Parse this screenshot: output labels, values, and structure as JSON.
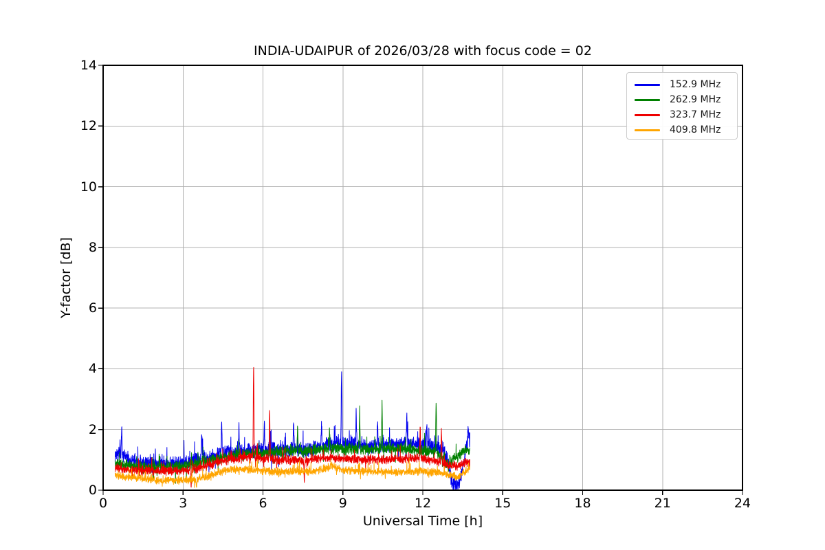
{
  "chart_data": {
    "type": "line",
    "title": "INDIA-UDAIPUR of 2026/03/28 with focus code = 02",
    "xlabel": "Universal Time [h]",
    "ylabel": "Y-factor [dB]",
    "xlim": [
      0,
      24
    ],
    "ylim": [
      0,
      14
    ],
    "xticks": [
      0,
      3,
      6,
      9,
      12,
      15,
      18,
      21,
      24
    ],
    "yticks": [
      0,
      2,
      4,
      6,
      8,
      10,
      12,
      14
    ],
    "grid": true,
    "grid_color": "#b0b0b0",
    "axis_color": "#000000",
    "legend": {
      "position": "upper-right"
    },
    "series": [
      {
        "label": "152.9 MHz",
        "color": "#0000ee",
        "seed": 7,
        "noise_amp": 0.28,
        "x_start": 0.45,
        "x_end": 13.77,
        "mean_points": [
          [
            0.45,
            1.2
          ],
          [
            0.8,
            1.1
          ],
          [
            1.2,
            0.92
          ],
          [
            1.8,
            0.85
          ],
          [
            2.4,
            0.88
          ],
          [
            3.0,
            0.92
          ],
          [
            3.6,
            1.05
          ],
          [
            4.2,
            1.15
          ],
          [
            5.0,
            1.28
          ],
          [
            6.0,
            1.35
          ],
          [
            7.0,
            1.35
          ],
          [
            7.6,
            1.3
          ],
          [
            8.3,
            1.5
          ],
          [
            9.0,
            1.55
          ],
          [
            9.6,
            1.5
          ],
          [
            10.2,
            1.45
          ],
          [
            10.8,
            1.5
          ],
          [
            11.4,
            1.55
          ],
          [
            12.0,
            1.5
          ],
          [
            12.4,
            1.45
          ],
          [
            12.8,
            1.3
          ],
          [
            12.95,
            0.9
          ],
          [
            13.1,
            0.25
          ],
          [
            13.25,
            0.15
          ],
          [
            13.4,
            0.3
          ],
          [
            13.55,
            1.0
          ],
          [
            13.65,
            1.5
          ],
          [
            13.77,
            1.7
          ]
        ],
        "spikes": [
          [
            0.7,
            2.1
          ],
          [
            3.7,
            2.05
          ],
          [
            4.45,
            2.1
          ],
          [
            5.1,
            1.95
          ],
          [
            6.05,
            2.3
          ],
          [
            7.15,
            2.25
          ],
          [
            8.2,
            2.2
          ],
          [
            8.95,
            4.0
          ],
          [
            9.5,
            2.3
          ],
          [
            10.3,
            2.2
          ],
          [
            11.4,
            2.3
          ],
          [
            12.15,
            2.2
          ],
          [
            13.7,
            2.1
          ]
        ]
      },
      {
        "label": "262.9 MHz",
        "color": "#008000",
        "seed": 11,
        "noise_amp": 0.22,
        "x_start": 0.45,
        "x_end": 13.77,
        "mean_points": [
          [
            0.45,
            0.88
          ],
          [
            1.0,
            0.8
          ],
          [
            1.8,
            0.73
          ],
          [
            2.6,
            0.75
          ],
          [
            3.2,
            0.8
          ],
          [
            3.8,
            0.95
          ],
          [
            4.4,
            1.05
          ],
          [
            5.0,
            1.15
          ],
          [
            5.6,
            1.2
          ],
          [
            6.4,
            1.25
          ],
          [
            7.2,
            1.3
          ],
          [
            8.0,
            1.32
          ],
          [
            9.0,
            1.38
          ],
          [
            10.0,
            1.32
          ],
          [
            11.0,
            1.38
          ],
          [
            11.8,
            1.32
          ],
          [
            12.3,
            1.28
          ],
          [
            12.75,
            1.1
          ],
          [
            12.95,
            0.8
          ],
          [
            13.15,
            1.05
          ],
          [
            13.45,
            1.2
          ],
          [
            13.65,
            1.35
          ],
          [
            13.77,
            1.3
          ]
        ],
        "spikes": [
          [
            7.3,
            1.95
          ],
          [
            8.5,
            2.0
          ],
          [
            9.63,
            2.6
          ],
          [
            10.47,
            2.8
          ],
          [
            12.5,
            2.95
          ]
        ]
      },
      {
        "label": "323.7 MHz",
        "color": "#ee0000",
        "seed": 23,
        "noise_amp": 0.17,
        "x_start": 0.45,
        "x_end": 13.77,
        "mean_points": [
          [
            0.45,
            0.74
          ],
          [
            1.0,
            0.68
          ],
          [
            1.8,
            0.62
          ],
          [
            2.6,
            0.63
          ],
          [
            3.2,
            0.67
          ],
          [
            3.8,
            0.78
          ],
          [
            4.4,
            0.95
          ],
          [
            5.0,
            1.05
          ],
          [
            5.5,
            1.1
          ],
          [
            6.0,
            1.05
          ],
          [
            6.6,
            1.0
          ],
          [
            7.4,
            0.98
          ],
          [
            8.2,
            1.05
          ],
          [
            9.0,
            1.05
          ],
          [
            9.8,
            1.0
          ],
          [
            10.6,
            1.0
          ],
          [
            11.4,
            1.05
          ],
          [
            12.0,
            1.05
          ],
          [
            12.5,
            0.95
          ],
          [
            13.0,
            0.82
          ],
          [
            13.35,
            0.8
          ],
          [
            13.6,
            0.9
          ],
          [
            13.77,
            0.92
          ]
        ],
        "spikes": [
          [
            3.3,
            0.12
          ],
          [
            5.65,
            3.98
          ],
          [
            6.25,
            2.65
          ],
          [
            7.55,
            0.3
          ],
          [
            11.9,
            2.1
          ],
          [
            12.7,
            1.95
          ]
        ]
      },
      {
        "label": "409.8 MHz",
        "color": "#ffa500",
        "seed": 5,
        "noise_amp": 0.15,
        "x_start": 0.45,
        "x_end": 13.77,
        "mean_points": [
          [
            0.45,
            0.5
          ],
          [
            0.9,
            0.44
          ],
          [
            1.5,
            0.38
          ],
          [
            2.1,
            0.34
          ],
          [
            2.8,
            0.32
          ],
          [
            3.4,
            0.34
          ],
          [
            3.9,
            0.45
          ],
          [
            4.4,
            0.6
          ],
          [
            4.9,
            0.7
          ],
          [
            5.4,
            0.68
          ],
          [
            6.0,
            0.64
          ],
          [
            6.6,
            0.6
          ],
          [
            7.2,
            0.62
          ],
          [
            7.8,
            0.62
          ],
          [
            8.3,
            0.7
          ],
          [
            8.6,
            0.8
          ],
          [
            9.0,
            0.66
          ],
          [
            9.6,
            0.62
          ],
          [
            10.4,
            0.6
          ],
          [
            11.2,
            0.6
          ],
          [
            12.0,
            0.62
          ],
          [
            12.6,
            0.58
          ],
          [
            13.0,
            0.5
          ],
          [
            13.3,
            0.42
          ],
          [
            13.55,
            0.6
          ],
          [
            13.77,
            0.7
          ]
        ],
        "spikes": [
          [
            3.5,
            0.1
          ],
          [
            8.55,
            0.95
          ]
        ]
      }
    ]
  }
}
